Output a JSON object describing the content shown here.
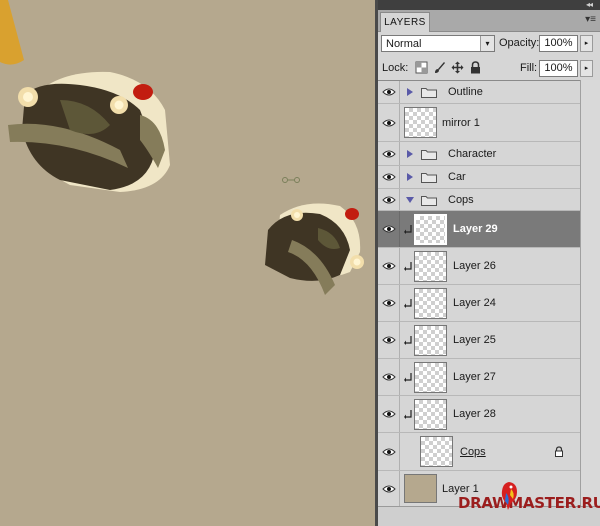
{
  "panel": {
    "tab_label": "LAYERS",
    "collapse_glyph": "◂◂",
    "menu_glyph": "▾≡",
    "blend_mode": "Normal",
    "opacity_label": "Opacity:",
    "opacity_value": "100%",
    "lock_label": "Lock:",
    "fill_label": "Fill:",
    "fill_value": "100%",
    "dropdown_arrow": "▾",
    "stepper_arrow": "▸"
  },
  "layers": [
    {
      "name": "Outline",
      "kind": "group",
      "expanded": false
    },
    {
      "name": "mirror 1",
      "kind": "layer"
    },
    {
      "name": "Character",
      "kind": "group",
      "expanded": false
    },
    {
      "name": "Car",
      "kind": "group",
      "expanded": false
    },
    {
      "name": "Cops",
      "kind": "group",
      "expanded": true
    },
    {
      "name": "Layer 29",
      "kind": "clipped",
      "selected": true
    },
    {
      "name": "Layer 26",
      "kind": "clipped"
    },
    {
      "name": "Layer 24",
      "kind": "clipped"
    },
    {
      "name": "Layer 25",
      "kind": "clipped"
    },
    {
      "name": "Layer 27",
      "kind": "clipped"
    },
    {
      "name": "Layer 28",
      "kind": "clipped"
    },
    {
      "name": "Cops",
      "kind": "base",
      "locked": true
    },
    {
      "name": "Layer 1",
      "kind": "background"
    }
  ],
  "icons": {
    "visibility": "eye-icon",
    "group": "folder-icon",
    "clip": "clipping-arrow-icon",
    "lock": "lock-icon"
  },
  "colors": {
    "canvas": "#b5a88e",
    "panel": "#d6d6d6",
    "selected_row": "#7a7a7a",
    "watermark": "#9b1d1d"
  },
  "watermark": {
    "text": "DRAWMASTER.RU"
  }
}
